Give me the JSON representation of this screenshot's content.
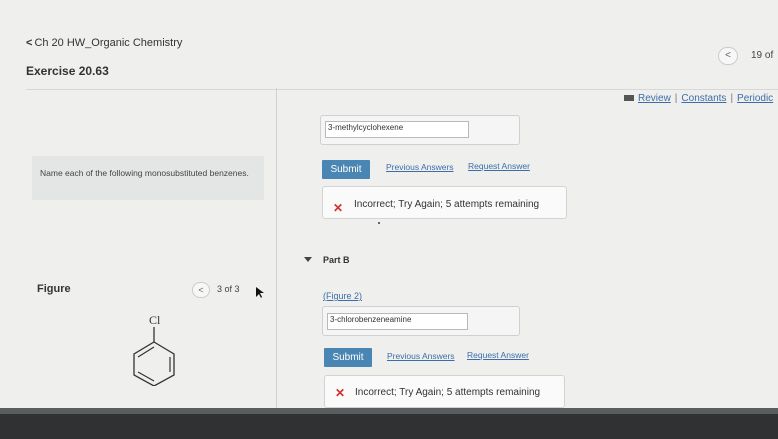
{
  "header": {
    "back_label": "Ch 20 HW_Organic Chemistry",
    "exercise_title": "Exercise 20.63",
    "pager_count": "19 of"
  },
  "resources": {
    "review": "Review",
    "separator": "|",
    "constants": "Constants",
    "periodic": "Periodic"
  },
  "left_panel": {
    "instructions": "Name each of the following monosubstituted benzenes.",
    "figure_label": "Figure",
    "figure_pager": "3 of 3",
    "molecule_label": "Cl"
  },
  "part_a": {
    "answer_value": "3-methylcyclohexene",
    "submit_label": "Submit",
    "previous_answers": "Previous Answers",
    "request_answer": "Request Answer",
    "feedback_icon": "x-icon",
    "feedback_text": "Incorrect; Try Again; 5 attempts remaining"
  },
  "part_b": {
    "title": "Part B",
    "figure_link": "(Figure 2)",
    "answer_value": "3-chlorobenzeneamine",
    "submit_label": "Submit",
    "previous_answers": "Previous Answers",
    "request_answer": "Request Answer",
    "feedback_text": "Incorrect; Try Again; 5 attempts remaining"
  },
  "colors": {
    "submit_bg": "#4a86b3",
    "link": "#3b6ea8",
    "error_x": "#d0312d",
    "background": "#efefee"
  }
}
